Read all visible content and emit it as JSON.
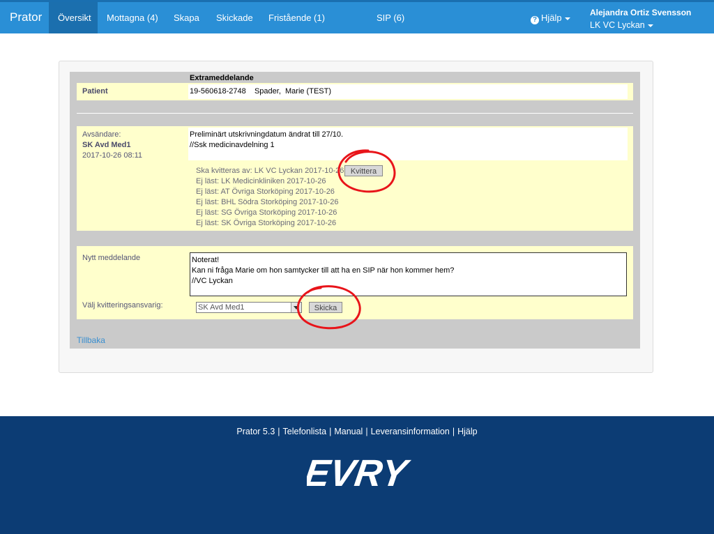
{
  "nav": {
    "brand": "Prator",
    "items": [
      {
        "label": "Översikt",
        "active": true
      },
      {
        "label": "Mottagna (4)"
      },
      {
        "label": "Skapa"
      },
      {
        "label": "Skickade"
      },
      {
        "label": "Fristående (1)"
      },
      {
        "label": "SIP (6)"
      }
    ],
    "help_label": "Hjälp",
    "user_name": "Alejandra Ortiz Svensson",
    "user_unit": "LK VC Lyckan"
  },
  "message": {
    "header_title": "Extrameddelande",
    "patient_label": "Patient",
    "patient_value": "19-560618-2748    Spader,  Marie (TEST)",
    "sender_label": "Avsändare:",
    "sender_name": "SK Avd Med1",
    "sender_date": "2017-10-26 08:11",
    "body_lines": [
      "Preliminärt utskrivningdatum ändrat till 27/10.",
      "//Ssk medicinavdelning 1"
    ],
    "status_lines": [
      "Ska kvitteras av: LK VC Lyckan  2017-10-26",
      "Ej läst: LK Medicinkliniken  2017-10-26",
      "Ej läst: AT Övriga Storköping  2017-10-26",
      "Ej läst: BHL Södra Storköping  2017-10-26",
      "Ej läst: SG Övriga Storköping  2017-10-26",
      "Ej läst: SK Övriga Storköping  2017-10-26"
    ],
    "kvittera_label": "Kvittera"
  },
  "new_message": {
    "label": "Nytt meddelande",
    "text_lines": [
      "Noterat!",
      "Kan ni fråga Marie om hon samtycker till att ha en SIP när hon kommer hem?",
      "//VC Lyckan"
    ],
    "select_label": "Välj kvitteringsansvarig:",
    "select_value": "SK Avd Med1",
    "send_label": "Skicka"
  },
  "back_link": "Tillbaka",
  "footer": {
    "links": [
      "Prator 5.3",
      "Telefonlista",
      "Manual",
      "Leveransinformation",
      "Hjälp"
    ],
    "logo_text": "EVRY"
  },
  "colors": {
    "nav_bg": "#2a8fd6",
    "nav_active": "#1b6fae",
    "panel_yellow": "#ffffcc",
    "frame_gray": "#cacaca",
    "footer_bg": "#0c3c74",
    "annotation_red": "#e8141a"
  }
}
